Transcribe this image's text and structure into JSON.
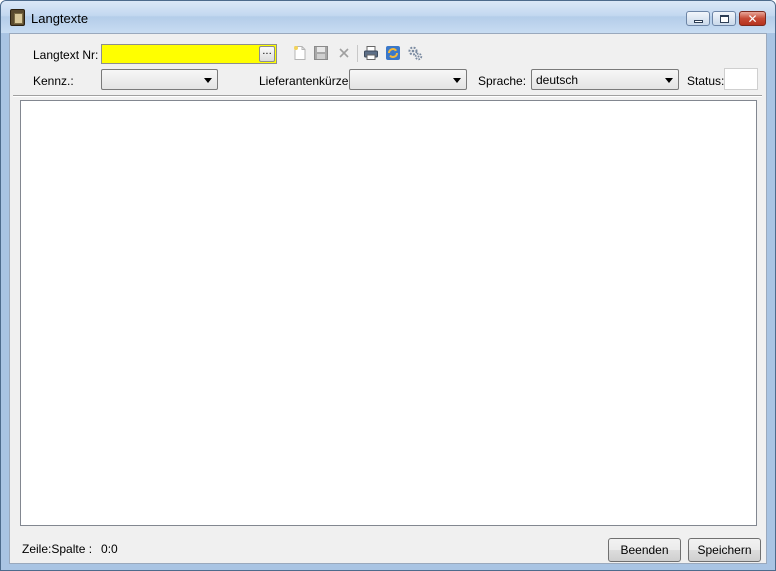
{
  "window": {
    "title": "Langtexte"
  },
  "form": {
    "langtext_nr_label": "Langtext Nr:",
    "langtext_nr_value": "",
    "browse_label": "...",
    "kennz_label": "Kennz.:",
    "kennz_value": "",
    "lieferant_label": "Lieferantenkürzel:",
    "lieferant_value": "",
    "sprache_label": "Sprache:",
    "sprache_value": "deutsch",
    "status_label": "Status:",
    "status_value": ""
  },
  "toolbar": {
    "icons": [
      "new-document-icon",
      "save-icon",
      "delete-icon",
      "print-icon",
      "refresh-icon",
      "settings-gears-icon"
    ]
  },
  "editor": {
    "content": ""
  },
  "statusbar": {
    "position_label": "Zeile:Spalte :",
    "position_value": "0:0"
  },
  "buttons": {
    "beenden": "Beenden",
    "speichern": "Speichern"
  },
  "colors": {
    "required_field": "#ffff00",
    "close_button": "#c64a35"
  }
}
